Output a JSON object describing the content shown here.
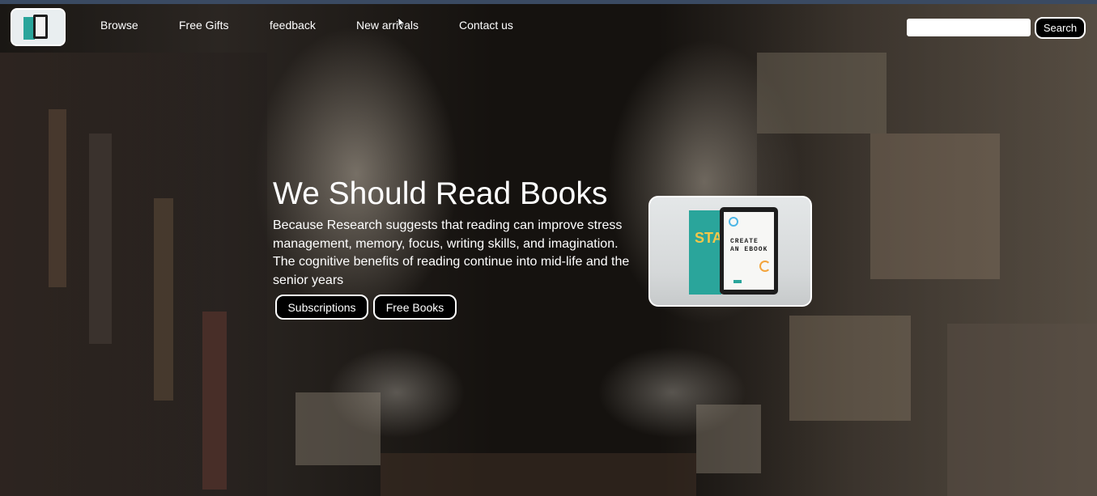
{
  "header": {
    "logo_icon": "ebook-logo-icon",
    "nav": [
      {
        "label": "Browse"
      },
      {
        "label": "Free Gifts"
      },
      {
        "label": "feedback"
      },
      {
        "label": "New arrivals"
      },
      {
        "label": "Contact us"
      }
    ],
    "search": {
      "value": "",
      "button_label": "Search"
    }
  },
  "hero": {
    "title": "We Should Read Books",
    "description": "Because Research suggests that reading can improve stress management, memory, focus, writing skills, and imagination. The cognitive benefits of reading continue into mid-life and the senior years",
    "buttons": [
      {
        "label": "Subscriptions"
      },
      {
        "label": "Free Books"
      }
    ],
    "card": {
      "book_cover_text": "STA",
      "tablet_line1": "CREATE",
      "tablet_line2": "AN EBOOK"
    }
  },
  "colors": {
    "accent_teal": "#2aa59b",
    "button_bg": "#000000",
    "text": "#ffffff"
  }
}
